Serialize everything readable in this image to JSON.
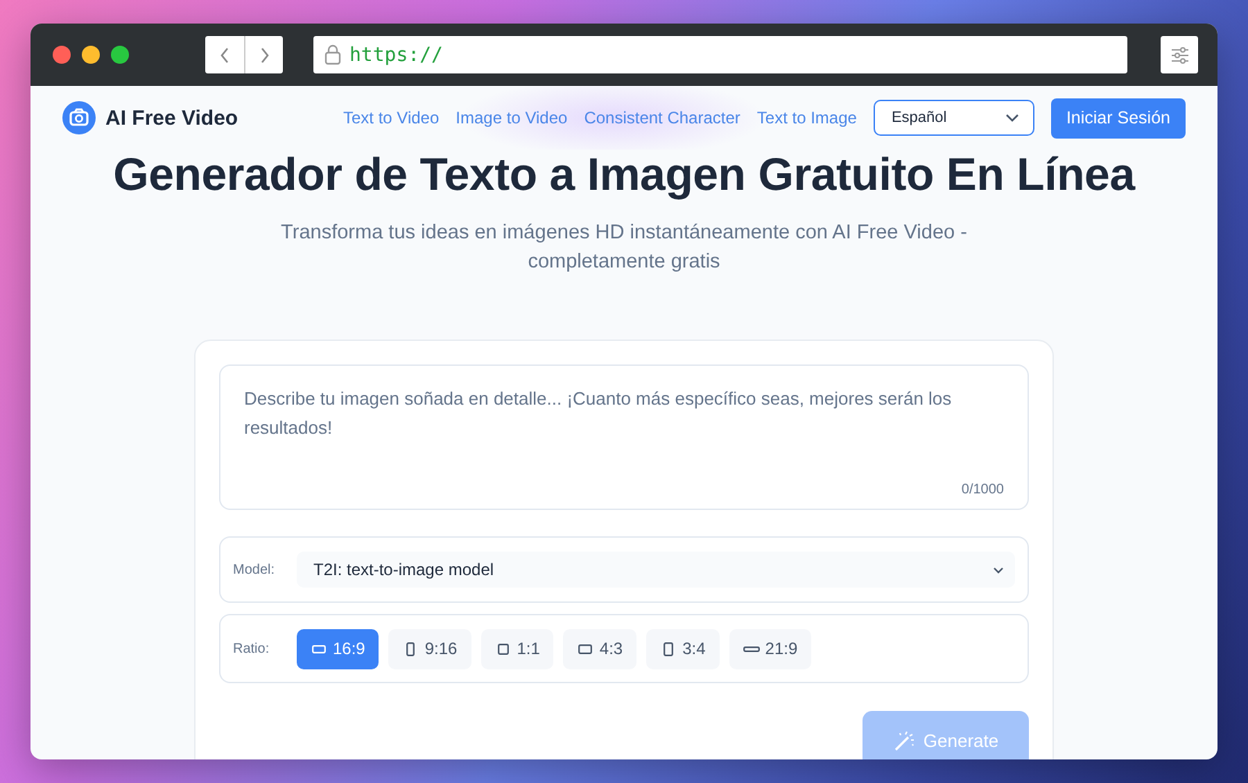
{
  "browser": {
    "url": "https://"
  },
  "nav": {
    "brand": "AI Free Video",
    "links": [
      {
        "label": "Text to Video",
        "selected": false
      },
      {
        "label": "Image to Video",
        "selected": false
      },
      {
        "label": "Consistent Character",
        "selected": false
      },
      {
        "label": "Text to Image",
        "selected": false
      }
    ],
    "language": "Español",
    "login": "Iniciar Sesión"
  },
  "hero": {
    "title": "Generador de Texto a Imagen Gratuito En Línea",
    "subtitle": "Transforma tus ideas en imágenes HD instantáneamente con AI Free Video - completamente gratis"
  },
  "generator": {
    "prompt": {
      "placeholder": "Describe tu imagen soñada en detalle... ¡Cuanto más específico seas, mejores serán los resultados!",
      "counter": "0/1000"
    },
    "model": {
      "label": "Model:",
      "value": "T2I: text-to-image model"
    },
    "ratio": {
      "label": "Ratio:",
      "options": [
        {
          "label": "16:9",
          "kind": "wide",
          "selected": true
        },
        {
          "label": "9:16",
          "kind": "tall",
          "selected": false
        },
        {
          "label": "1:1",
          "kind": "square",
          "selected": false
        },
        {
          "label": "4:3",
          "kind": "landscape",
          "selected": false
        },
        {
          "label": "3:4",
          "kind": "portrait",
          "selected": false
        },
        {
          "label": "21:9",
          "kind": "ultrawide",
          "selected": false
        }
      ]
    },
    "generate": {
      "label": "Generate",
      "disabled": true
    }
  }
}
